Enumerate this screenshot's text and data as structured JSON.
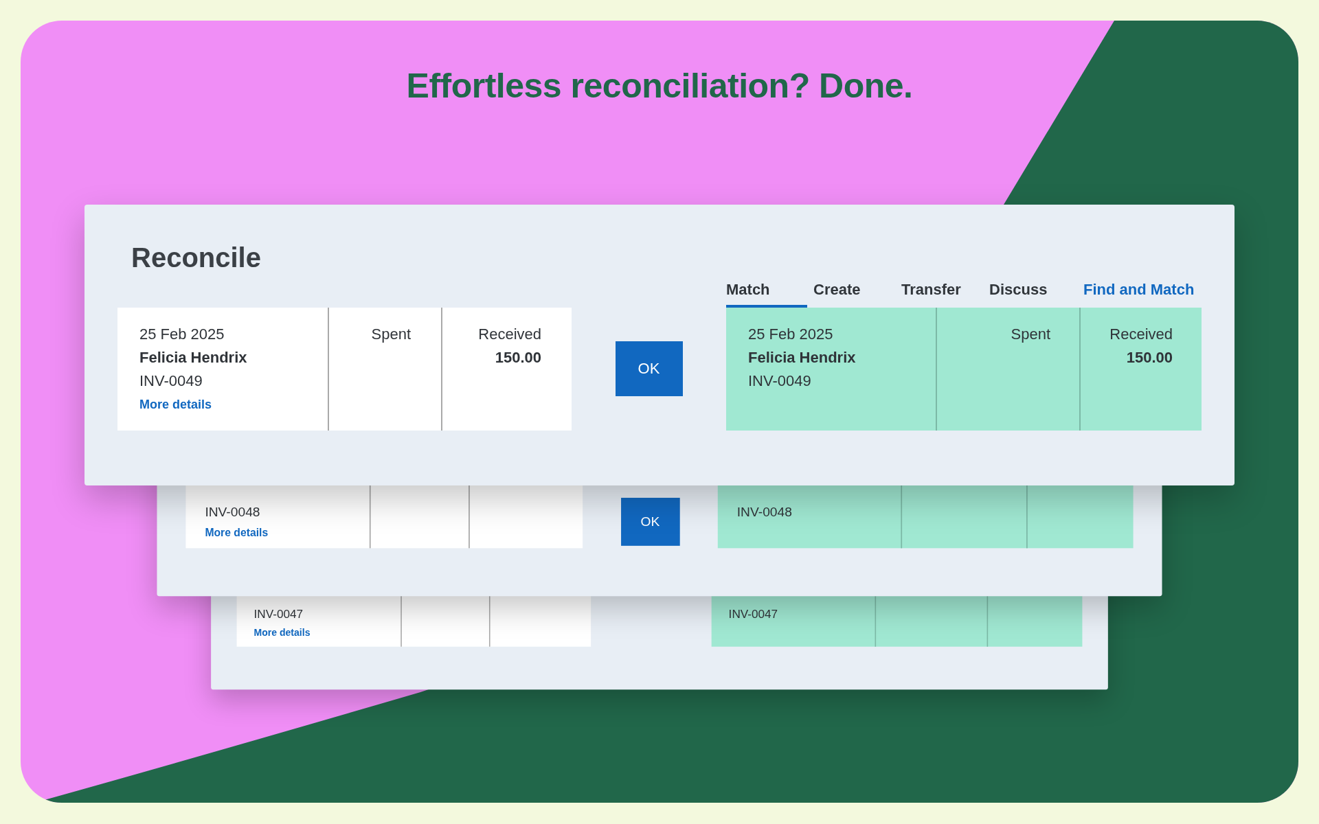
{
  "heading": "Effortless reconciliation? Done.",
  "dialog": {
    "title": "Reconcile",
    "tabs": [
      {
        "label": "Match",
        "selected": true,
        "kind": "tab"
      },
      {
        "label": "Create",
        "selected": false,
        "kind": "tab"
      },
      {
        "label": "Transfer",
        "selected": false,
        "kind": "tab"
      },
      {
        "label": "Discuss",
        "selected": false,
        "kind": "tab"
      },
      {
        "label": "Find and Match",
        "selected": false,
        "kind": "link"
      }
    ],
    "statement": {
      "date": "25 Feb 2025",
      "name": "Felicia Hendrix",
      "reference": "INV-0049",
      "link": "More details",
      "spent_label": "Spent",
      "received_label": "Received",
      "received": "150.00"
    },
    "ok": "OK",
    "match": {
      "date": "25 Feb 2025",
      "name": "Felicia Hendrix",
      "reference": "INV-0049",
      "spent_label": "Spent",
      "received_label": "Received",
      "received": "150.00"
    }
  },
  "background_cards": [
    {
      "reference": "INV-0048",
      "link": "More details",
      "ok": "OK",
      "match_reference": "INV-0048"
    },
    {
      "reference": "INV-0047",
      "link": "More details",
      "match_reference": "INV-0047"
    }
  ]
}
